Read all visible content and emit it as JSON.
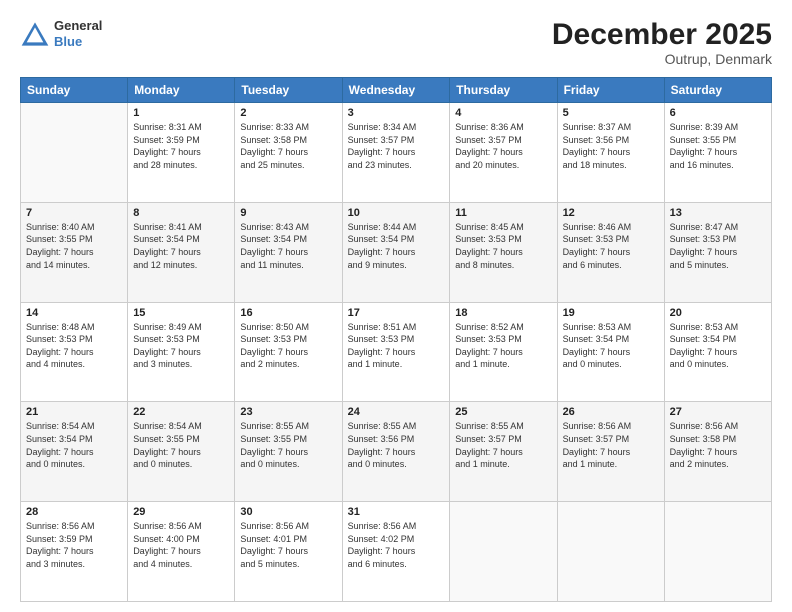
{
  "header": {
    "logo_general": "General",
    "logo_blue": "Blue",
    "month": "December 2025",
    "location": "Outrup, Denmark"
  },
  "weekdays": [
    "Sunday",
    "Monday",
    "Tuesday",
    "Wednesday",
    "Thursday",
    "Friday",
    "Saturday"
  ],
  "weeks": [
    [
      {
        "day": "",
        "info": ""
      },
      {
        "day": "1",
        "info": "Sunrise: 8:31 AM\nSunset: 3:59 PM\nDaylight: 7 hours\nand 28 minutes."
      },
      {
        "day": "2",
        "info": "Sunrise: 8:33 AM\nSunset: 3:58 PM\nDaylight: 7 hours\nand 25 minutes."
      },
      {
        "day": "3",
        "info": "Sunrise: 8:34 AM\nSunset: 3:57 PM\nDaylight: 7 hours\nand 23 minutes."
      },
      {
        "day": "4",
        "info": "Sunrise: 8:36 AM\nSunset: 3:57 PM\nDaylight: 7 hours\nand 20 minutes."
      },
      {
        "day": "5",
        "info": "Sunrise: 8:37 AM\nSunset: 3:56 PM\nDaylight: 7 hours\nand 18 minutes."
      },
      {
        "day": "6",
        "info": "Sunrise: 8:39 AM\nSunset: 3:55 PM\nDaylight: 7 hours\nand 16 minutes."
      }
    ],
    [
      {
        "day": "7",
        "info": "Sunrise: 8:40 AM\nSunset: 3:55 PM\nDaylight: 7 hours\nand 14 minutes."
      },
      {
        "day": "8",
        "info": "Sunrise: 8:41 AM\nSunset: 3:54 PM\nDaylight: 7 hours\nand 12 minutes."
      },
      {
        "day": "9",
        "info": "Sunrise: 8:43 AM\nSunset: 3:54 PM\nDaylight: 7 hours\nand 11 minutes."
      },
      {
        "day": "10",
        "info": "Sunrise: 8:44 AM\nSunset: 3:54 PM\nDaylight: 7 hours\nand 9 minutes."
      },
      {
        "day": "11",
        "info": "Sunrise: 8:45 AM\nSunset: 3:53 PM\nDaylight: 7 hours\nand 8 minutes."
      },
      {
        "day": "12",
        "info": "Sunrise: 8:46 AM\nSunset: 3:53 PM\nDaylight: 7 hours\nand 6 minutes."
      },
      {
        "day": "13",
        "info": "Sunrise: 8:47 AM\nSunset: 3:53 PM\nDaylight: 7 hours\nand 5 minutes."
      }
    ],
    [
      {
        "day": "14",
        "info": "Sunrise: 8:48 AM\nSunset: 3:53 PM\nDaylight: 7 hours\nand 4 minutes."
      },
      {
        "day": "15",
        "info": "Sunrise: 8:49 AM\nSunset: 3:53 PM\nDaylight: 7 hours\nand 3 minutes."
      },
      {
        "day": "16",
        "info": "Sunrise: 8:50 AM\nSunset: 3:53 PM\nDaylight: 7 hours\nand 2 minutes."
      },
      {
        "day": "17",
        "info": "Sunrise: 8:51 AM\nSunset: 3:53 PM\nDaylight: 7 hours\nand 1 minute."
      },
      {
        "day": "18",
        "info": "Sunrise: 8:52 AM\nSunset: 3:53 PM\nDaylight: 7 hours\nand 1 minute."
      },
      {
        "day": "19",
        "info": "Sunrise: 8:53 AM\nSunset: 3:54 PM\nDaylight: 7 hours\nand 0 minutes."
      },
      {
        "day": "20",
        "info": "Sunrise: 8:53 AM\nSunset: 3:54 PM\nDaylight: 7 hours\nand 0 minutes."
      }
    ],
    [
      {
        "day": "21",
        "info": "Sunrise: 8:54 AM\nSunset: 3:54 PM\nDaylight: 7 hours\nand 0 minutes."
      },
      {
        "day": "22",
        "info": "Sunrise: 8:54 AM\nSunset: 3:55 PM\nDaylight: 7 hours\nand 0 minutes."
      },
      {
        "day": "23",
        "info": "Sunrise: 8:55 AM\nSunset: 3:55 PM\nDaylight: 7 hours\nand 0 minutes."
      },
      {
        "day": "24",
        "info": "Sunrise: 8:55 AM\nSunset: 3:56 PM\nDaylight: 7 hours\nand 0 minutes."
      },
      {
        "day": "25",
        "info": "Sunrise: 8:55 AM\nSunset: 3:57 PM\nDaylight: 7 hours\nand 1 minute."
      },
      {
        "day": "26",
        "info": "Sunrise: 8:56 AM\nSunset: 3:57 PM\nDaylight: 7 hours\nand 1 minute."
      },
      {
        "day": "27",
        "info": "Sunrise: 8:56 AM\nSunset: 3:58 PM\nDaylight: 7 hours\nand 2 minutes."
      }
    ],
    [
      {
        "day": "28",
        "info": "Sunrise: 8:56 AM\nSunset: 3:59 PM\nDaylight: 7 hours\nand 3 minutes."
      },
      {
        "day": "29",
        "info": "Sunrise: 8:56 AM\nSunset: 4:00 PM\nDaylight: 7 hours\nand 4 minutes."
      },
      {
        "day": "30",
        "info": "Sunrise: 8:56 AM\nSunset: 4:01 PM\nDaylight: 7 hours\nand 5 minutes."
      },
      {
        "day": "31",
        "info": "Sunrise: 8:56 AM\nSunset: 4:02 PM\nDaylight: 7 hours\nand 6 minutes."
      },
      {
        "day": "",
        "info": ""
      },
      {
        "day": "",
        "info": ""
      },
      {
        "day": "",
        "info": ""
      }
    ]
  ]
}
